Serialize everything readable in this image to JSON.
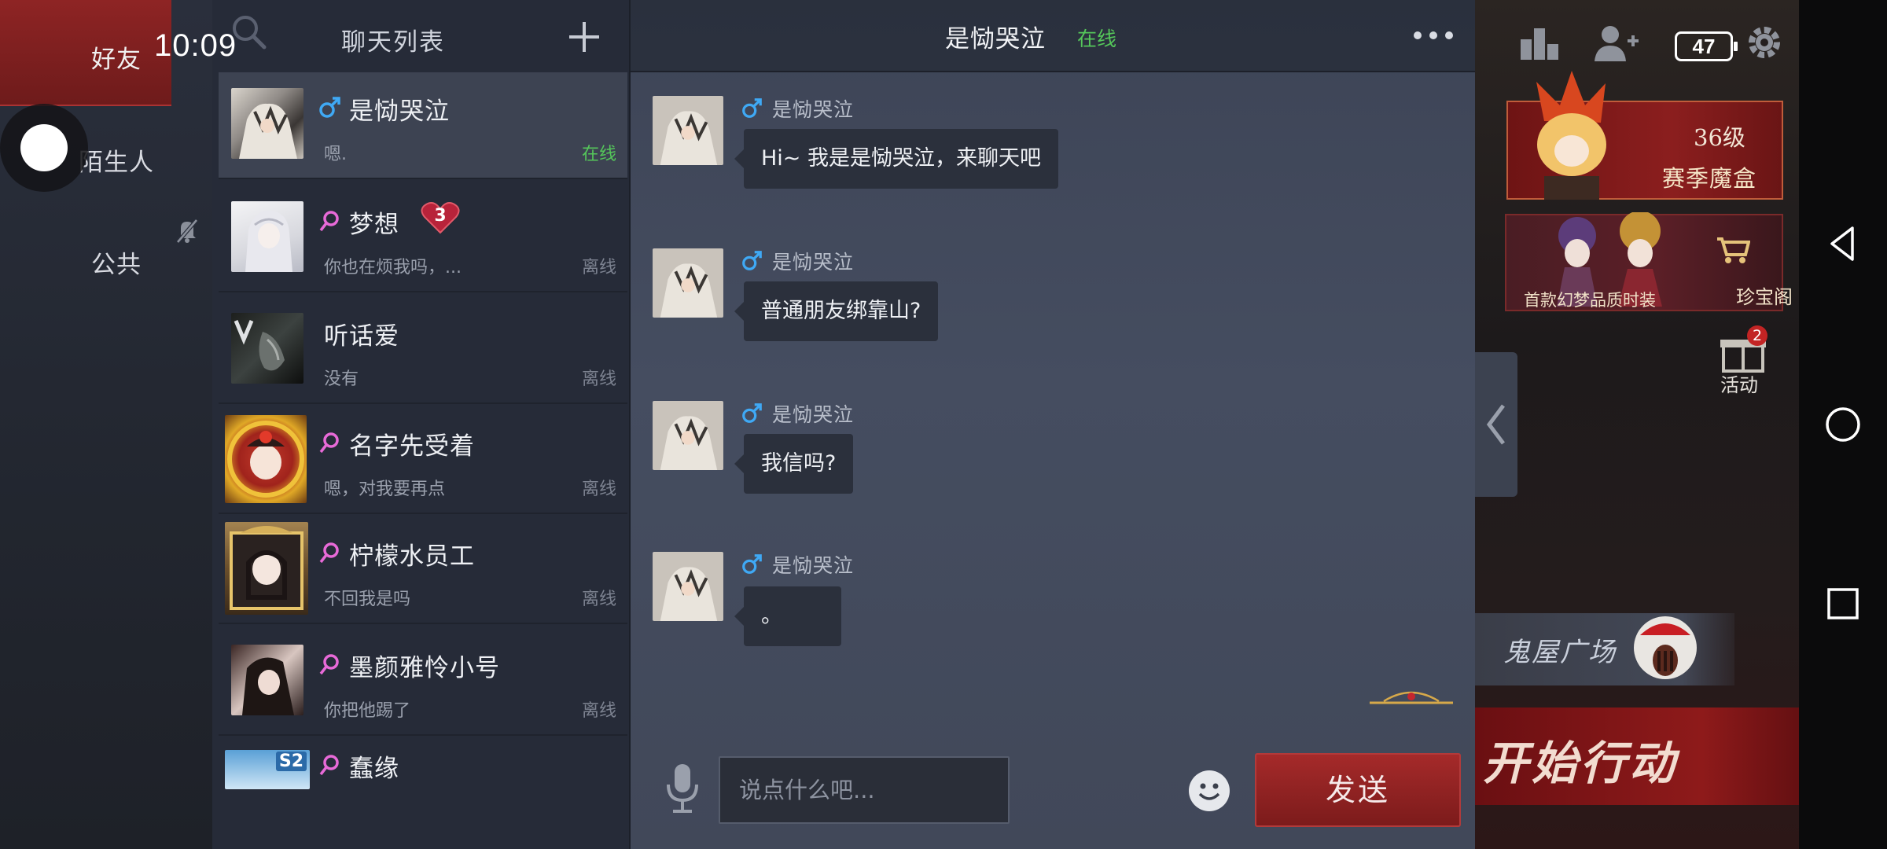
{
  "status_bar": {
    "time": "10:09",
    "battery": "47"
  },
  "tabs": [
    {
      "label": "好友",
      "active": true
    },
    {
      "label": "陌生人",
      "active": false
    },
    {
      "label": "公共",
      "active": false
    }
  ],
  "chat_list": {
    "title": "聊天列表",
    "contacts": [
      {
        "name": "是恸哭泣",
        "gender": "male",
        "last_message": "嗯.",
        "status": "在线",
        "online": true,
        "active": true
      },
      {
        "name": "梦想",
        "gender": "female",
        "last_message": "你也在烦我吗，...",
        "status": "离线",
        "online": false,
        "unread": "3"
      },
      {
        "name": "听话爱",
        "gender": "none",
        "last_message": "没有",
        "status": "离线",
        "online": false
      },
      {
        "name": "名字先受着",
        "gender": "female",
        "last_message": "嗯，对我要再点",
        "status": "离线",
        "online": false
      },
      {
        "name": "柠檬水员工",
        "gender": "female",
        "last_message": "不回我是吗",
        "status": "离线",
        "online": false
      },
      {
        "name": "墨颜雅怜小号",
        "gender": "female",
        "last_message": "你把他踢了",
        "status": "离线",
        "online": false
      },
      {
        "name": "蠢缘",
        "gender": "female",
        "last_message": "",
        "status": "",
        "online": false,
        "avatar_badge": "S2"
      }
    ]
  },
  "chat": {
    "partner_name": "是恸哭泣",
    "partner_status": "在线",
    "messages": [
      {
        "sender": "是恸哭泣",
        "text": "Hi~ 我是是恸哭泣，来聊天吧"
      },
      {
        "sender": "是恸哭泣",
        "text": "普通朋友绑靠山?"
      },
      {
        "sender": "是恸哭泣",
        "text": "我信吗?"
      },
      {
        "sender": "是恸哭泣",
        "text": "。"
      }
    ],
    "input_placeholder": "说点什么吧...",
    "send_label": "发送"
  },
  "game": {
    "season_level": "36级",
    "season_title": "赛季魔盒",
    "shop_caption": "首款幻梦品质时装",
    "treasure_label": "珍宝阁",
    "activity_label": "活动",
    "activity_badge": "2",
    "haunted_label": "鬼屋广场",
    "start_label": "开始行动"
  },
  "colors": {
    "accent_red": "#8e2424",
    "online_green": "#55c75a",
    "male_blue": "#3fa9f5",
    "female_pink": "#e86ad8"
  },
  "icons": [
    "search-icon",
    "add-icon",
    "mute-icon",
    "more-icon",
    "voice-icon",
    "emoji-icon",
    "male-icon",
    "female-icon",
    "settings-icon",
    "add-friend-icon",
    "ranking-icon"
  ]
}
